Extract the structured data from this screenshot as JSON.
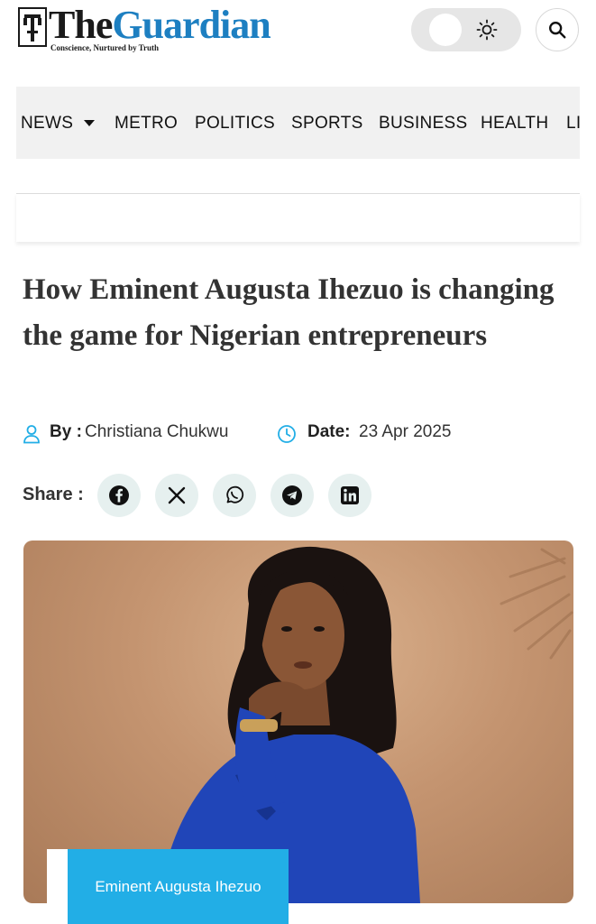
{
  "header": {
    "logo_the": "The",
    "logo_guardian": "Guardian",
    "tagline": "Conscience, Nurtured by Truth",
    "toggle_icon": "sun-icon",
    "search_icon": "search-icon"
  },
  "nav": {
    "items": [
      {
        "label": "NEWS"
      },
      {
        "label": "METRO"
      },
      {
        "label": "POLITICS"
      },
      {
        "label": "SPORTS"
      },
      {
        "label": "BUSINESS"
      },
      {
        "label": "HEALTH"
      },
      {
        "label": "LI"
      }
    ]
  },
  "article": {
    "title": "How Eminent Augusta Ihezuo is changing the game for Nigerian entrepreneurs",
    "by_label": "By :",
    "author": "Christiana Chukwu",
    "date_label": "Date:",
    "date": "23 Apr 2025",
    "share_label": "Share :",
    "share_icons": [
      "facebook-icon",
      "x-icon",
      "whatsapp-icon",
      "telegram-icon",
      "linkedin-icon"
    ],
    "image_caption": "Eminent Augusta Ihezuo"
  },
  "colors": {
    "brand_blue": "#1d7fc1",
    "accent_blue": "#22aee6",
    "nav_bg": "#f1f1f1",
    "share_bg": "#e6f0ef"
  }
}
